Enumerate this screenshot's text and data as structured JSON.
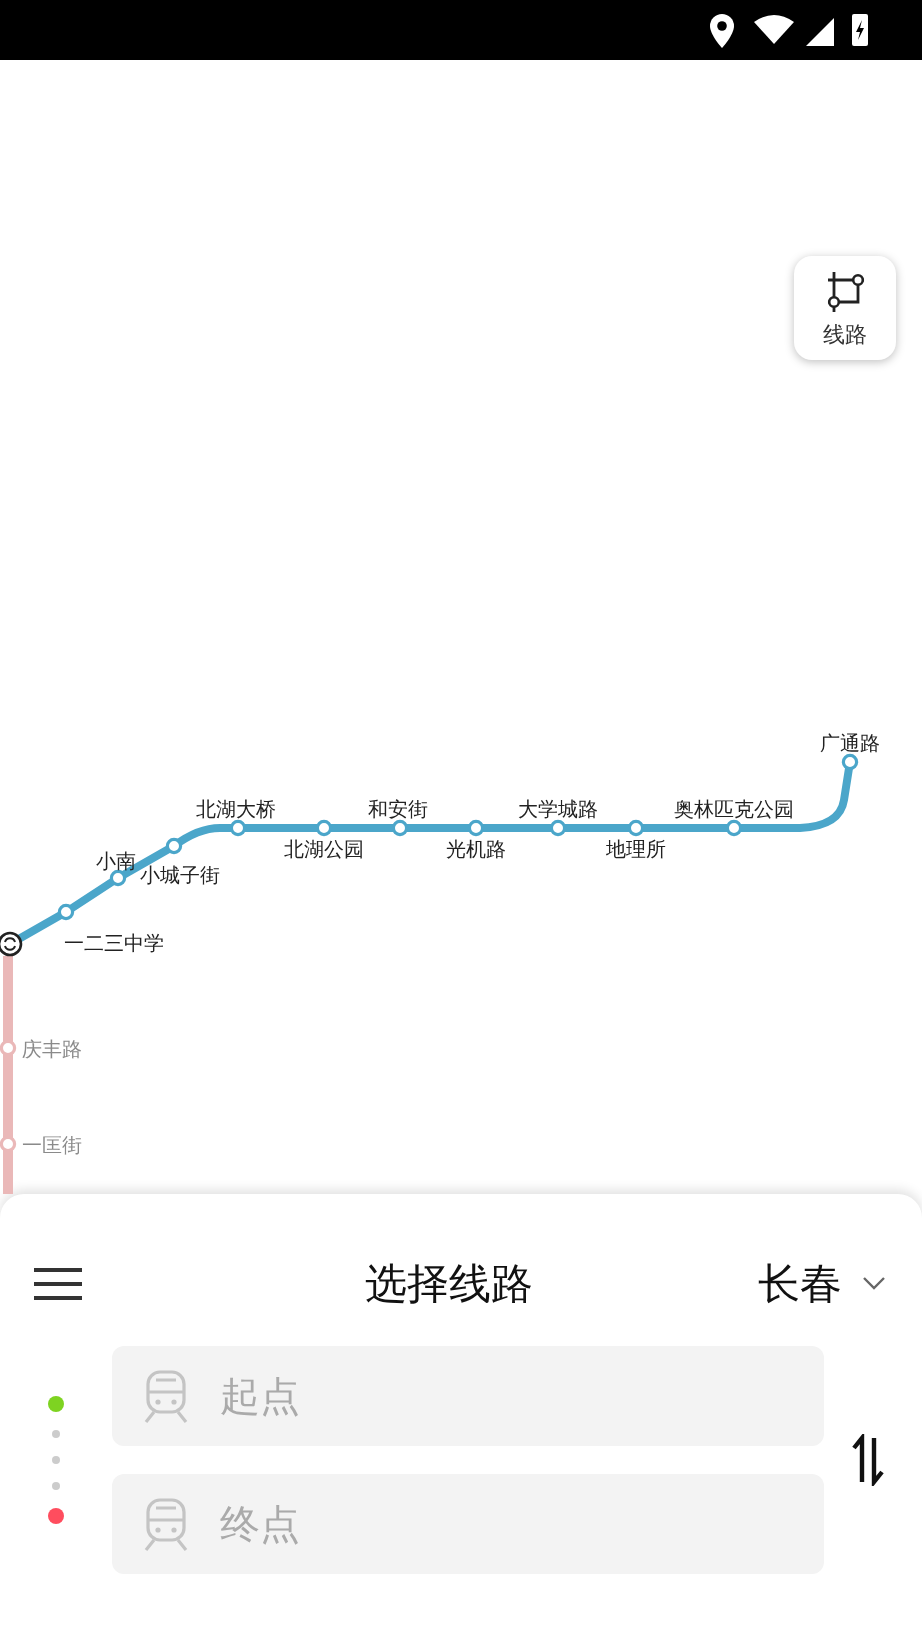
{
  "route_button": {
    "label": "线路"
  },
  "map": {
    "lines": [
      {
        "color": "#4ba6ca",
        "dimmed": false,
        "stations": [
          {
            "name": "一二三中学"
          },
          {
            "name": "小南"
          },
          {
            "name": "小城子街"
          },
          {
            "name": "北湖大桥"
          },
          {
            "name": "北湖公园"
          },
          {
            "name": "和安街"
          },
          {
            "name": "光机路"
          },
          {
            "name": "大学城路"
          },
          {
            "name": "地理所"
          },
          {
            "name": "奥林匹克公园"
          },
          {
            "name": "广通路"
          }
        ]
      },
      {
        "color": "#eab8b8",
        "dimmed": true,
        "stations": [
          {
            "name": "庆丰路"
          },
          {
            "name": "一匡街"
          }
        ]
      }
    ]
  },
  "panel": {
    "title": "选择线路",
    "city": "长春",
    "fields": [
      {
        "placeholder": "起点",
        "color": "#7ed321"
      },
      {
        "placeholder": "终点",
        "color": "#ff4d5e"
      }
    ]
  }
}
